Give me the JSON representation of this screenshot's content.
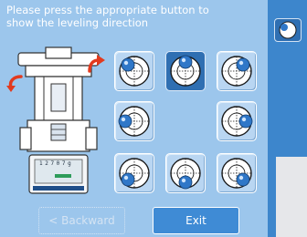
{
  "dialog": {
    "instruction": "Please press the appropriate button to\nshow the leveling direction"
  },
  "display": {
    "value": "1 2 7 0 7 g"
  },
  "level_buttons": [
    {
      "position": "top-left",
      "selected": false
    },
    {
      "position": "top",
      "selected": true
    },
    {
      "position": "top-right",
      "selected": false
    },
    {
      "position": "left",
      "selected": false
    },
    {
      "position": "right",
      "selected": false
    },
    {
      "position": "bottom-left",
      "selected": false
    },
    {
      "position": "bottom",
      "selected": false
    },
    {
      "position": "bottom-right",
      "selected": false
    }
  ],
  "buttons": {
    "backward_label": "< Backward",
    "exit_label": "Exit"
  },
  "colors": {
    "panel_background": "#9cc6ec",
    "screen_background": "#3d86cc",
    "selected_button": "#2f6fb2",
    "bubble": "#2f77c8",
    "arrow": "#e23a1e"
  },
  "icons": {
    "rotate_left": "rotate-left-arrow-icon",
    "rotate_right": "rotate-right-arrow-icon",
    "level_indicator": "level-bubble-icon"
  }
}
